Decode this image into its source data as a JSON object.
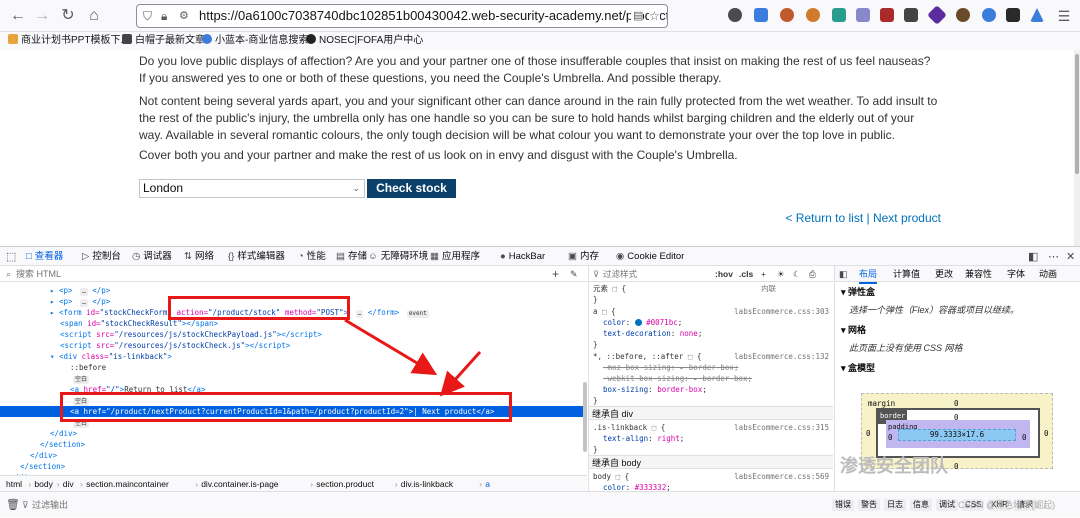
{
  "browser": {
    "url": "https://0a6100c7038740dbc102851b00430042.web-security-academy.net/product?productI"
  },
  "bookmarks": [
    {
      "label": "商业计划书PPT模板下...",
      "color": "#e8a33c"
    },
    {
      "label": "白帽子最新文章",
      "color": "#444444"
    },
    {
      "label": "小蓝本-商业信息搜索",
      "color": "#3b7ddd"
    },
    {
      "label": "NOSEC|FOFA用户中心",
      "color": "#222222"
    }
  ],
  "page": {
    "paragraphs": [
      "Do you love public displays of affection? Are you and your partner one of those insufferable couples that insist on making the rest of us feel nauseas? If you answered yes to one or both of these questions, you need the Couple's Umbrella. And possible therapy.",
      "Not content being several yards apart, you and your significant other can dance around in the rain fully protected from the wet weather. To add insult to the rest of the public's injury, the umbrella only has one handle so you can be sure to hold hands whilst barging children and the elderly out of your way. Available in several romantic colours, the only tough decision will be what colour you want to demonstrate your over the top love in public.",
      "Cover both you and your partner and make the rest of us look on in envy and disgust with the Couple's Umbrella."
    ],
    "stock_select_value": "London",
    "check_stock_label": "Check stock",
    "return_link": "< Return to list",
    "separator": " | ",
    "next_link": "Next product"
  },
  "devtools": {
    "tabs": [
      {
        "icon": "□",
        "label": "查看器",
        "active": true
      },
      {
        "icon": "▷",
        "label": "控制台"
      },
      {
        "icon": "◷",
        "label": "调试器"
      },
      {
        "icon": "⇅",
        "label": "网络"
      },
      {
        "icon": "{}",
        "label": "样式编辑器"
      },
      {
        "icon": "◔",
        "label": "性能"
      },
      {
        "icon": "▤",
        "label": "存储"
      },
      {
        "icon": "☺",
        "label": "无障碍环境"
      },
      {
        "icon": "▦",
        "label": "应用程序"
      },
      {
        "icon": "●",
        "label": "HackBar"
      },
      {
        "icon": "▣",
        "label": "内存"
      },
      {
        "icon": "◉",
        "label": "Cookie Editor"
      }
    ],
    "search_placeholder": "搜索 HTML",
    "html_lines": [
      {
        "indent": 5,
        "html": "<span class='tg'>▸ &lt;p&gt;</span> <span class='badge'>…</span> <span class='tg'>&lt;/p&gt;</span>"
      },
      {
        "indent": 5,
        "html": "<span class='tg'>▸ &lt;p&gt;</span> <span class='badge'>…</span> <span class='tg'>&lt;/p&gt;</span>"
      },
      {
        "indent": 5,
        "html": "<span class='tg'>▸ &lt;form</span> <span class='an'>id=</span><span class='av'>\"stockCheckForm\"</span> <span class='an'>action=</span><span class='av'>\"/product/stock\"</span> <span class='an'>method=</span><span class='av'>\"POST\"</span><span class='tg'>&gt;</span> <span class='badge'>…</span> <span class='tg'>&lt;/form&gt;</span> <span class='badge'>event</span>"
      },
      {
        "indent": 6,
        "html": "<span class='tg'>&lt;span</span> <span class='an'>id=</span><span class='av'>\"stockCheckResult\"</span><span class='tg'>&gt;&lt;/span&gt;</span>"
      },
      {
        "indent": 6,
        "html": "<span class='tg'>&lt;script</span> <span class='an'>src=</span><span class='av'>\"/resources/js/stockCheckPayload.js\"</span><span class='tg'>&gt;&lt;/script&gt;</span>"
      },
      {
        "indent": 6,
        "html": "<span class='tg'>&lt;script</span> <span class='an'>src=</span><span class='av'>\"/resources/js/stockCheck.js\"</span><span class='tg'>&gt;&lt;/script&gt;</span>"
      },
      {
        "indent": 5,
        "html": "<span class='tg'>▾ &lt;div</span> <span class='an'>class=</span><span class='av'>\"is-linkback\"</span><span class='tg'>&gt;</span>"
      },
      {
        "indent": 7,
        "html": "<span class='tx'>::before</span>"
      },
      {
        "indent": 7,
        "html": "<span class='badge'>空白</span>"
      },
      {
        "indent": 7,
        "html": "<span class='tg'>&lt;a</span> <span class='an'>href=</span><span class='av'>\"/\"</span><span class='tg'>&gt;</span><span class='tx'>Return to list</span><span class='tg'>&lt;/a&gt;</span>"
      },
      {
        "indent": 7,
        "html": "<span class='badge'>空白</span>"
      },
      {
        "indent": 7,
        "selected": true,
        "html": "<span class='tg'>&lt;a</span> <span class='an'>href=</span><span class='av'>\"/product/nextProduct?currentProductId=1&amp;path=/product?productId=2\"</span><span class='tg'>&gt;</span>| Next product<span class='tg'>&lt;/a&gt;</span>"
      },
      {
        "indent": 7,
        "html": "<span class='badge'>空白</span>"
      },
      {
        "indent": 5,
        "html": "<span class='tg'>&lt;/div&gt;</span>"
      },
      {
        "indent": 4,
        "html": "<span class='tg'>&lt;/section&gt;</span>"
      },
      {
        "indent": 3,
        "html": "<span class='tg'>&lt;/div&gt;</span>"
      },
      {
        "indent": 2,
        "html": "<span class='tg'>&lt;/section&gt;</span>"
      },
      {
        "indent": 1,
        "html": "<span class='tg'>&lt;/div&gt;</span>"
      }
    ],
    "breadcrumb": [
      "html",
      "body",
      "div",
      "section.maincontainer",
      "div.container.is-page",
      "section.product",
      "div.is-linkback",
      "a"
    ],
    "rules": {
      "filter_placeholder": "过滤样式",
      "hov": ":hov",
      "cls": ".cls",
      "element_label": "元素",
      "inline_label": "内联",
      "a_rule_source": "labsEcommerce.css:303",
      "a_color": "#0071bc",
      "a_text_decoration": "none",
      "universal_source": "labsEcommerce.css:132",
      "inherited_div": "继承自 div",
      "linkback_source": "labsEcommerce.css:315",
      "inherited_body": "继承自 body",
      "body_source": "labsEcommerce.css:569",
      "body_color": "#333332"
    },
    "layout": {
      "tabs": [
        "布局",
        "计算值",
        "更改",
        "兼容性",
        "字体",
        "动画"
      ],
      "flexbox_title": "弹性盒",
      "flexbox_text": "选择一个弹性（Flex）容器或项目以继续。",
      "grid_title": "网格",
      "grid_text": "此页面上没有使用 CSS 网格",
      "boxmodel_title": "盒模型",
      "margin_label": "margin",
      "border_label": "border",
      "padding_label": "padding",
      "content_size": "99.3333×17.6",
      "zero": "0"
    },
    "console": {
      "filter_placeholder": "过滤输出",
      "buttons": [
        "错误",
        "警告",
        "日志",
        "信息",
        "调试",
        "CSS",
        "XHR",
        "请求"
      ]
    }
  },
  "watermark": "渗透安全团队",
  "csdn": "CSDN @黑色地带(崛起)"
}
